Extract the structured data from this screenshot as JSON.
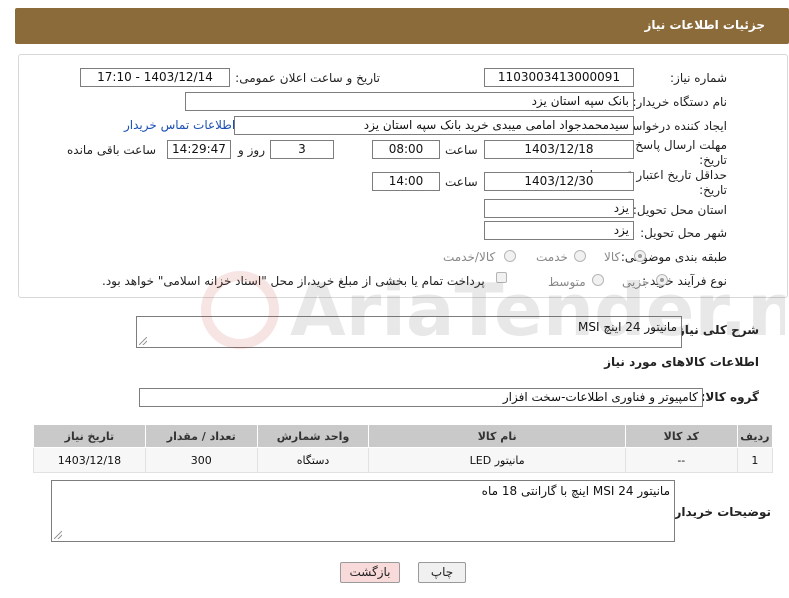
{
  "header": {
    "title": "جزئیات اطلاعات نیاز"
  },
  "form": {
    "need_number_label": "شماره نیاز:",
    "need_number": "1103003413000091",
    "announce_label": "تاریخ و ساعت اعلان عمومی:",
    "announce_value": "1403/12/14 - 17:10",
    "buyer_org_label": "نام دستگاه خریدار:",
    "buyer_org": "بانک سپه استان یزد",
    "creator_label": "ایجاد کننده درخواست:",
    "creator": "سیدمحمدجواد امامی میبدی خرید   بانک سپه استان یزد",
    "contact_link": "اطلاعات تماس خریدار",
    "reply_deadline_label": "مهلت ارسال پاسخ: تا تاریخ:",
    "reply_date": "1403/12/18",
    "time_label": "ساعت",
    "reply_time": "08:00",
    "days_value": "3",
    "days_label": "روز و",
    "remaining_time": "14:29:47",
    "remaining_label": "ساعت باقی مانده",
    "price_validity_label": "حداقل تاریخ اعتبار قیمت: تا تاریخ:",
    "price_date": "1403/12/30",
    "price_time": "14:00",
    "province_label": "استان محل تحویل:",
    "province": "یزد",
    "city_label": "شهر محل تحویل:",
    "city": "یزد",
    "category_label": "طبقه بندی موضوعی:",
    "category_options": [
      "کالا",
      "خدمت",
      "کالا/خدمت"
    ],
    "process_label": "نوع فرآیند خرید :",
    "process_options": [
      "جزیی",
      "متوسط"
    ],
    "payment_note": "پرداخت تمام یا بخشی از مبلغ خرید،از محل \"اسناد خزانه اسلامی\" خواهد بود."
  },
  "summary": {
    "label": "شرح کلی نیاز:",
    "value": "مانیتور 24 اینچ MSI"
  },
  "goods": {
    "section_title": "اطلاعات کالاهای مورد نیاز",
    "group_label": "گروه کالا:",
    "group_value": "کامپیوتر و فناوری اطلاعات-سخت افزار",
    "columns": [
      "ردیف",
      "کد کالا",
      "نام کالا",
      "واحد شمارش",
      "تعداد / مقدار",
      "تاریخ نیاز"
    ],
    "rows": [
      {
        "row": "1",
        "code": "--",
        "name": "مانیتور LED",
        "unit": "دستگاه",
        "qty": "300",
        "date": "1403/12/18"
      }
    ]
  },
  "buyer_notes": {
    "label": "توضیحات خریدار:",
    "value": "مانیتور 24 MSI اینچ با گارانتی 18 ماه"
  },
  "buttons": {
    "print": "چاپ",
    "back": "بازگشت"
  },
  "watermark": {
    "text": "AriaTender.neT"
  },
  "colors": {
    "header_bg": "#8b6b3a",
    "link": "#1a4fb3",
    "table_header": "#c9c9c9",
    "back_button": "#f9dada"
  }
}
